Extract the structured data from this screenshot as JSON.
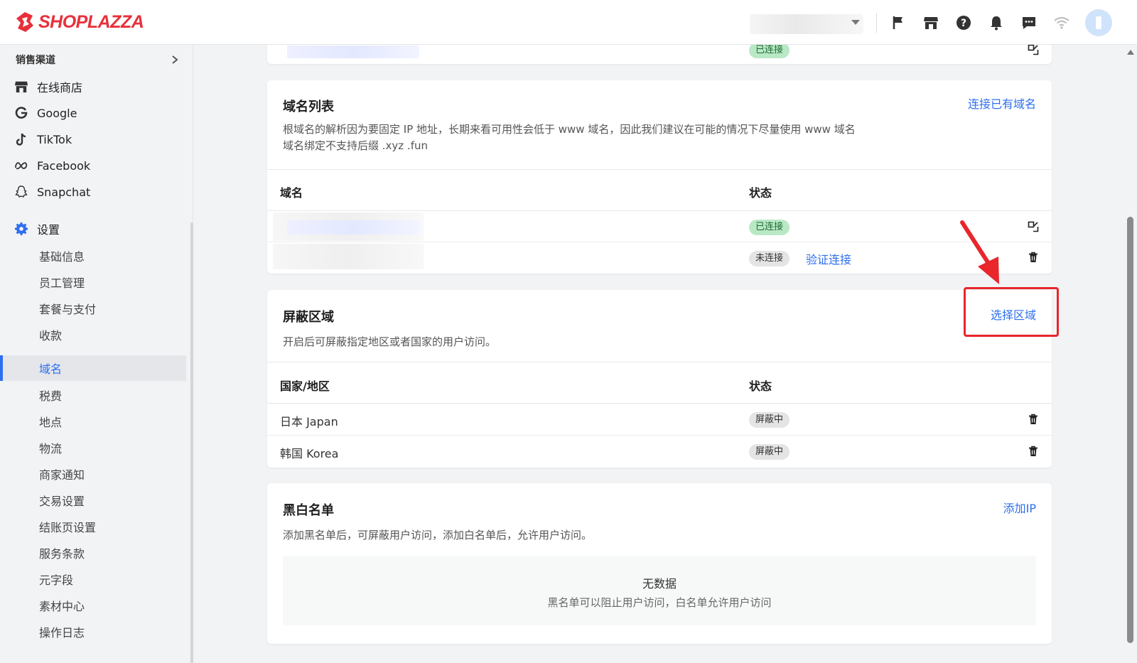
{
  "brand": {
    "name": "SHOPLAZZA",
    "color": "#e8303b"
  },
  "topbar": {
    "icons": [
      "flag-icon",
      "store-icon",
      "help-icon",
      "bell-icon",
      "message-icon",
      "wifi-icon",
      "avatar"
    ]
  },
  "sidebar": {
    "section_label": "销售渠道",
    "channels": [
      {
        "label": "在线商店",
        "icon": "store-icon"
      },
      {
        "label": "Google",
        "icon": "google-icon"
      },
      {
        "label": "TikTok",
        "icon": "tiktok-icon"
      },
      {
        "label": "Facebook",
        "icon": "meta-icon"
      },
      {
        "label": "Snapchat",
        "icon": "snapchat-icon"
      }
    ],
    "settings_label": "设置",
    "settings_items": [
      "基础信息",
      "员工管理",
      "套餐与支付",
      "收款",
      "域名",
      "税费",
      "地点",
      "物流",
      "商家通知",
      "交易设置",
      "结账页设置",
      "服务条款",
      "元字段",
      "素材中心",
      "操作日志"
    ],
    "active_item": "域名"
  },
  "top_partial": {
    "status": "已连接"
  },
  "domain_list": {
    "title": "域名列表",
    "action": "连接已有域名",
    "desc_line1": "根域名的解析因为要固定 IP 地址，长期来看可用性会低于 www 域名，因此我们建议在可能的情况下尽量使用 www 域名",
    "desc_line2": "域名绑定不支持后缀 .xyz .fun",
    "col_domain": "域名",
    "col_status": "状态",
    "rows": [
      {
        "status": "已连接"
      },
      {
        "status": "未连接",
        "action": "验证连接"
      }
    ]
  },
  "block_region": {
    "title": "屏蔽区域",
    "action": "选择区域",
    "desc": "开启后可屏蔽指定地区或者国家的用户访问。",
    "col_region": "国家/地区",
    "col_status": "状态",
    "rows": [
      {
        "region": "日本 Japan",
        "status": "屏蔽中"
      },
      {
        "region": "韩国 Korea",
        "status": "屏蔽中"
      }
    ]
  },
  "blacklist": {
    "title": "黑白名单",
    "action": "添加IP",
    "desc": "添加黑名单后，可屏蔽用户访问，添加白名单后，允许用户访问。",
    "empty_title": "无数据",
    "empty_desc": "黑名单可以阻止用户访问，白名单允许用户访问"
  },
  "annotation": {
    "color": "#e8262b"
  }
}
